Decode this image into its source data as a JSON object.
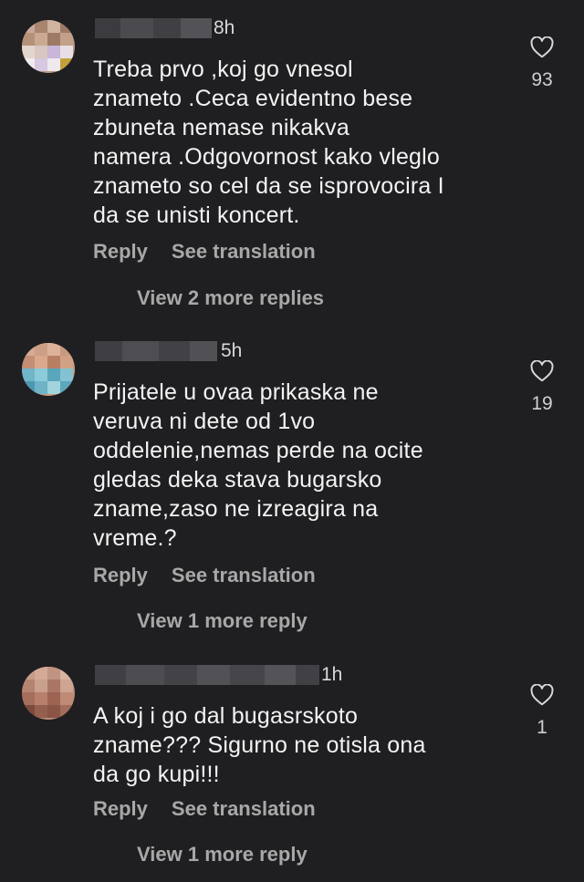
{
  "comments": [
    {
      "time": "8h",
      "text": "Treba prvo ,koj go vnesol\nznameto .Ceca evidentno bese\nzbuneta nemase nikakva\nnamera .Odgovornost kako vleglo\nznameto so cel da se isprovocira I\nda se unisti koncert.",
      "reply_label": "Reply",
      "translate_label": "See translation",
      "view_more_label": "View 2 more replies",
      "like_count": "93"
    },
    {
      "time": "5h",
      "text": "Prijatele u ovaa prikaska ne\nveruva ni dete od 1vo\noddelenie,nemas perde na ocite\ngledas deka stava bugarsko\nzname,zaso ne izreagira na\nvreme.?",
      "reply_label": "Reply",
      "translate_label": "See translation",
      "view_more_label": "View 1 more reply",
      "like_count": "19"
    },
    {
      "time": "1h",
      "text": "A koj i go dal bugasrskoto\nzname??? Sigurno ne otisla ona\nda go kupi!!!",
      "reply_label": "Reply",
      "translate_label": "See translation",
      "view_more_label": "View 1 more reply",
      "like_count": "1"
    }
  ],
  "colors": {
    "background": "#1f1f22",
    "text": "#f3f3f3",
    "muted": "#a8a8a8"
  },
  "icons": {
    "like": "heart-outline-icon"
  }
}
